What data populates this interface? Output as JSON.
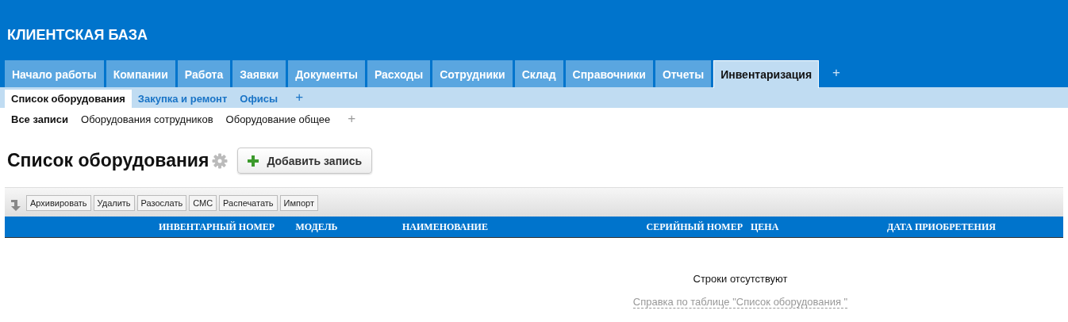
{
  "app_title": "КЛИЕНТСКАЯ БАЗА",
  "tabs": [
    {
      "label": "Начало работы",
      "selected": false
    },
    {
      "label": "Компании",
      "selected": false
    },
    {
      "label": "Работа",
      "selected": false
    },
    {
      "label": "Заявки",
      "selected": false
    },
    {
      "label": "Документы",
      "selected": false
    },
    {
      "label": "Расходы",
      "selected": false
    },
    {
      "label": "Сотрудники",
      "selected": false
    },
    {
      "label": "Склад",
      "selected": false
    },
    {
      "label": "Справочники",
      "selected": false
    },
    {
      "label": "Отчеты",
      "selected": false
    },
    {
      "label": "Инвентаризация",
      "selected": true
    }
  ],
  "tabs_add": "+",
  "subtabs": [
    {
      "label": "Список оборудования",
      "selected": true
    },
    {
      "label": "Закупка и ремонт",
      "selected": false
    },
    {
      "label": "Офисы",
      "selected": false
    }
  ],
  "subtabs_add": "+",
  "filters": [
    {
      "label": "Все записи",
      "selected": true
    },
    {
      "label": "Оборудования сотрудников",
      "selected": false
    },
    {
      "label": "Оборудование общее",
      "selected": false
    }
  ],
  "filters_add": "+",
  "page_title": "Список оборудования",
  "add_button": "Добавить запись",
  "toolbar_buttons": [
    "Архивировать",
    "Удалить",
    "Разослать",
    "СМС",
    "Распечатать",
    "Импорт"
  ],
  "table": {
    "columns": [
      "ИНВЕНТАРНЫЙ НОМЕР",
      "МОДЕЛЬ",
      "НАИМЕНОВАНИЕ",
      "СЕРИЙНЫЙ НОМЕР",
      "ЦЕНА",
      "ДАТА ПРИОБРЕТЕНИЯ"
    ],
    "empty_message": "Строки отсутствуют",
    "help_link": "Справка по таблице \"Список оборудования \""
  }
}
